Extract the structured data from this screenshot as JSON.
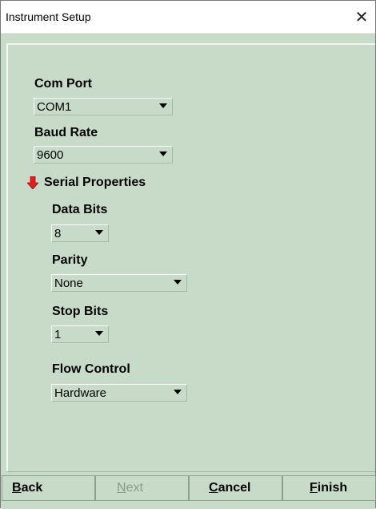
{
  "window": {
    "title": "Instrument Setup",
    "close_glyph": "✕"
  },
  "com_port": {
    "label": "Com Port",
    "value": "COM1"
  },
  "baud_rate": {
    "label": "Baud Rate",
    "value": "9600"
  },
  "serial_properties": {
    "label": "Serial Properties",
    "icon": "down-arrow-icon",
    "icon_color": "#e02020",
    "data_bits": {
      "label": "Data Bits",
      "value": "8"
    },
    "parity": {
      "label": "Parity",
      "value": "None"
    },
    "stop_bits": {
      "label": "Stop Bits",
      "value": "1"
    },
    "flow_control": {
      "label": "Flow Control",
      "value": "Hardware"
    }
  },
  "buttons": {
    "back": "Back",
    "next": "Next",
    "cancel": "Cancel",
    "finish": "Finish"
  },
  "colors": {
    "panel_bg": "#c8dbc8"
  }
}
